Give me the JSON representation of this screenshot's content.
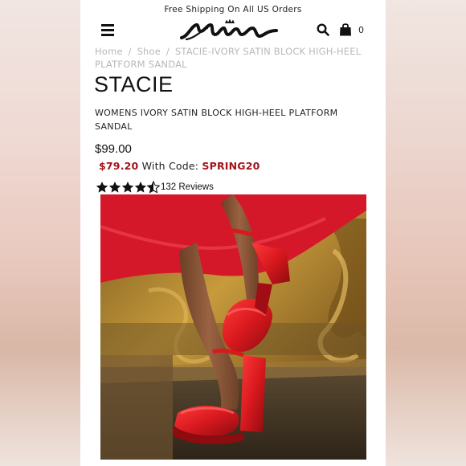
{
  "promo_bar": {
    "text": "Free Shipping On All US Orders"
  },
  "header": {
    "logo_text": "Nina",
    "cart_count": "0",
    "icons": [
      "menu-icon",
      "search-icon",
      "shopping-bag-icon"
    ]
  },
  "breadcrumb": {
    "items": [
      "Home",
      "Shoe",
      "STACIE-IVORY SATIN BLOCK HIGH-HEEL PLATFORM SANDAL"
    ],
    "separator": "/"
  },
  "product": {
    "name": "STACIE",
    "description": "WOMENS IVORY SATIN BLOCK HIGH-HEEL PLATFORM SANDAL",
    "price": "$99.00",
    "sale_price": "$79.20",
    "code_label": "With Code:",
    "code": "SPRING20",
    "rating": 4.5,
    "reviews": "132 Reviews"
  },
  "colors": {
    "accent_red": "#a3151b",
    "breadcrumb_gray": "#b9b9b9",
    "shoe_red": "#d8191e"
  }
}
